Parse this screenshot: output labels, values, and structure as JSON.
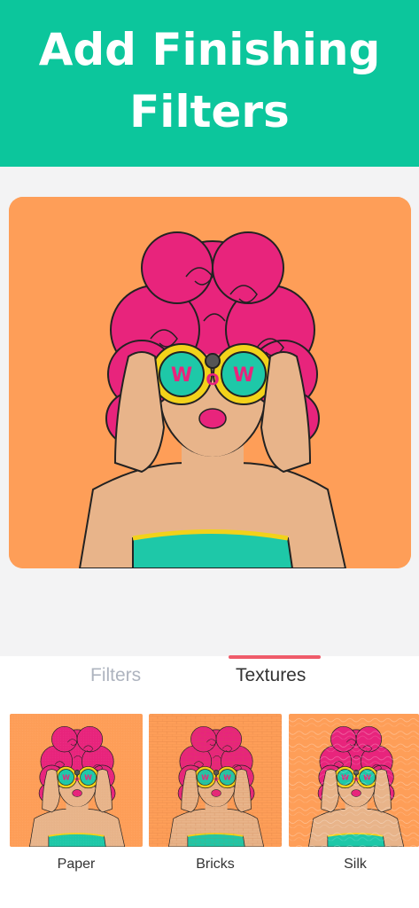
{
  "banner": {
    "line1": "Add Finishing",
    "line2": "Filters"
  },
  "tabs": [
    {
      "label": "Filters",
      "active": false
    },
    {
      "label": "Textures",
      "active": true
    }
  ],
  "textures": [
    {
      "label": "Paper"
    },
    {
      "label": "Bricks"
    },
    {
      "label": "Silk"
    }
  ],
  "colors": {
    "banner": "#0cc69c",
    "accent": "#ef5b6a",
    "artwork_bg": "#fe9e58",
    "hair": "#e8247c"
  }
}
